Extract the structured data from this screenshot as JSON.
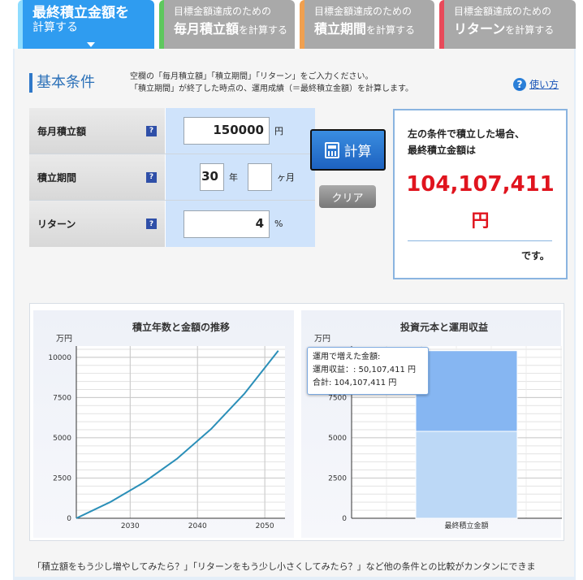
{
  "tabs": [
    {
      "line1": "最終積立金額を",
      "line2": "計算する"
    },
    {
      "small": "目標金額達成のための",
      "big": "毎月積立額",
      "suffix": "を計算する"
    },
    {
      "small": "目標金額達成のための",
      "big": "積立期間",
      "suffix": "を計算する"
    },
    {
      "small": "目標金額達成のための",
      "big": "リターン",
      "suffix": "を計算する"
    }
  ],
  "section": {
    "title": "基本条件",
    "desc1": "空欄の「毎月積立額」「積立期間」「リターン」をご入力ください。",
    "desc2": "「積立期間」が終了した時点の、運用成績（＝最終積立金額）を計算します。",
    "howto_icon": "?",
    "howto": "使い方"
  },
  "form": {
    "monthly_label": "毎月積立額",
    "monthly_value": "150000",
    "monthly_unit": "円",
    "period_label": "積立期間",
    "period_years": "30",
    "period_years_unit": "年",
    "period_months": "",
    "period_months_unit": "ヶ月",
    "return_label": "リターン",
    "return_value": "4",
    "return_unit": "%",
    "help_icon": "?"
  },
  "buttons": {
    "calc": "計算",
    "clear": "クリア"
  },
  "result": {
    "line1": "左の条件で積立した場合、",
    "line2": "最終積立金額は",
    "amount": "104,107,411",
    "unit": "円",
    "suffix": "です。"
  },
  "chart_data": [
    {
      "type": "line",
      "title": "積立年数と金額の推移",
      "ylabel": "万円",
      "xlabel": "",
      "x": [
        2022,
        2027,
        2032,
        2037,
        2042,
        2047,
        2052
      ],
      "y": [
        0,
        997,
        2221,
        3714,
        5536,
        7758,
        10411
      ],
      "x_ticks": [
        "2030",
        "2040",
        "2050"
      ],
      "y_ticks": [
        "0",
        "2500",
        "5000",
        "7500",
        "10000"
      ],
      "xlim": [
        2022,
        2053
      ],
      "ylim": [
        0,
        10700
      ],
      "grid": true,
      "color": "#2b8fb8"
    },
    {
      "type": "bar",
      "title": "投資元本と運用収益",
      "ylabel": "万円",
      "categories": [
        "最終積立金額"
      ],
      "series": [
        {
          "values": [
            5400
          ],
          "color": "#bcd8f6"
        },
        {
          "values": [
            5011
          ],
          "color": "#86b6f2"
        }
      ],
      "y_ticks": [
        "0",
        "2500",
        "5000",
        "7500"
      ],
      "ylim": [
        0,
        10700
      ],
      "stacked": true,
      "grid": true,
      "tooltip": {
        "title": "運用で増えた金額:",
        "line1": "運用収益：: 50,107,411 円",
        "line2": "合計: 104,107,411 円"
      }
    }
  ],
  "footer": "「積立額をもう少し増やしてみたら？」「リターンをもう少し小さくしてみたら？」など他の条件との比較がカンタンにできま"
}
